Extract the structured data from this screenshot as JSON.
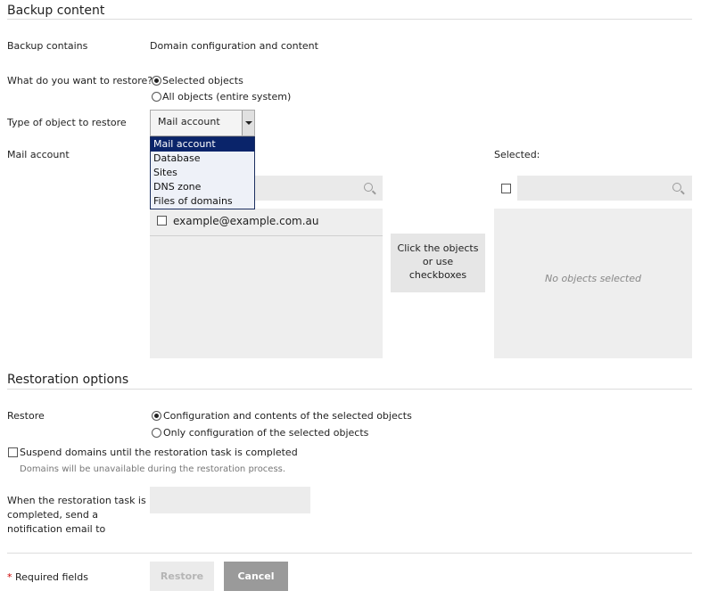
{
  "backup": {
    "title": "Backup content",
    "contains_label": "Backup contains",
    "contains_value": "Domain configuration and content",
    "restore_what_label": "What do you want to restore?",
    "restore_what_options": [
      "Selected objects",
      "All objects (entire system)"
    ],
    "restore_what_selected": 0,
    "object_type_label": "Type of object to restore",
    "object_type_value": "Mail account",
    "object_type_options": [
      "Mail account",
      "Database",
      "Sites",
      "DNS zone",
      "Files of domains"
    ],
    "mail_account_label": "Mail account"
  },
  "objects": {
    "available_items": [
      "example@example.com.au"
    ],
    "transfer_hint": [
      "Click the objects",
      "or use",
      "checkboxes"
    ],
    "selected_label": "Selected:",
    "selected_empty_text": "No objects selected"
  },
  "restoration": {
    "title": "Restoration options",
    "restore_label": "Restore",
    "restore_options": [
      "Configuration and contents of the selected objects",
      "Only configuration of the selected objects"
    ],
    "restore_selected": 0,
    "suspend_label": "Suspend domains until the restoration task is completed",
    "suspend_hint": "Domains will be unavailable during the restoration process.",
    "notify_label": [
      "When the restoration task is",
      "completed, send a",
      "notification email to"
    ],
    "notify_value": ""
  },
  "footer": {
    "required_star": "*",
    "required_text": "Required fields",
    "restore_button": "Restore",
    "cancel_button": "Cancel"
  },
  "colors": {
    "dropdown_highlight": "#0a246a",
    "panel_bg": "#eeeeee",
    "required_star": "#cc0000",
    "cancel_bg": "#9a9a9a"
  },
  "icons": [
    "search-icon",
    "checkbox-icon",
    "radio-icon",
    "dropdown-arrow-icon"
  ]
}
